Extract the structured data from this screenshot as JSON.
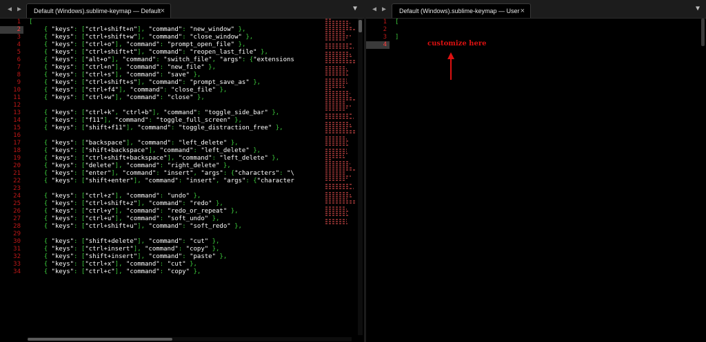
{
  "left_pane": {
    "tab_title": "Default (Windows).sublime-keymap — Default",
    "close_glyph": "×",
    "nav_back": "◀",
    "nav_forward": "▶",
    "dropdown_glyph": "▼",
    "lines": [
      "[",
      "    { \"keys\": [\"ctrl+shift+n\"], \"command\": \"new_window\" },",
      "    { \"keys\": [\"ctrl+shift+w\"], \"command\": \"close_window\" },",
      "    { \"keys\": [\"ctrl+o\"], \"command\": \"prompt_open_file\" },",
      "    { \"keys\": [\"ctrl+shift+t\"], \"command\": \"reopen_last_file\" },",
      "    { \"keys\": [\"alt+o\"], \"command\": \"switch_file\", \"args\": {\"extensions",
      "    { \"keys\": [\"ctrl+n\"], \"command\": \"new_file\" },",
      "    { \"keys\": [\"ctrl+s\"], \"command\": \"save\" },",
      "    { \"keys\": [\"ctrl+shift+s\"], \"command\": \"prompt_save_as\" },",
      "    { \"keys\": [\"ctrl+f4\"], \"command\": \"close_file\" },",
      "    { \"keys\": [\"ctrl+w\"], \"command\": \"close\" },",
      "",
      "    { \"keys\": [\"ctrl+k\", \"ctrl+b\"], \"command\": \"toggle_side_bar\" },",
      "    { \"keys\": [\"f11\"], \"command\": \"toggle_full_screen\" },",
      "    { \"keys\": [\"shift+f11\"], \"command\": \"toggle_distraction_free\" },",
      "",
      "    { \"keys\": [\"backspace\"], \"command\": \"left_delete\" },",
      "    { \"keys\": [\"shift+backspace\"], \"command\": \"left_delete\" },",
      "    { \"keys\": [\"ctrl+shift+backspace\"], \"command\": \"left_delete\" },",
      "    { \"keys\": [\"delete\"], \"command\": \"right_delete\" },",
      "    { \"keys\": [\"enter\"], \"command\": \"insert\", \"args\": {\"characters\": \"\\",
      "    { \"keys\": [\"shift+enter\"], \"command\": \"insert\", \"args\": {\"character",
      "",
      "    { \"keys\": [\"ctrl+z\"], \"command\": \"undo\" },",
      "    { \"keys\": [\"ctrl+shift+z\"], \"command\": \"redo\" },",
      "    { \"keys\": [\"ctrl+y\"], \"command\": \"redo_or_repeat\" },",
      "    { \"keys\": [\"ctrl+u\"], \"command\": \"soft_undo\" },",
      "    { \"keys\": [\"ctrl+shift+u\"], \"command\": \"soft_redo\" },",
      "",
      "    { \"keys\": [\"shift+delete\"], \"command\": \"cut\" },",
      "    { \"keys\": [\"ctrl+insert\"], \"command\": \"copy\" },",
      "    { \"keys\": [\"shift+insert\"], \"command\": \"paste\" },",
      "    { \"keys\": [\"ctrl+x\"], \"command\": \"cut\" },",
      "    { \"keys\": [\"ctrl+c\"], \"command\": \"copy\" },"
    ],
    "active_line": 2
  },
  "right_pane": {
    "tab_title": "Default (Windows).sublime-keymap — User",
    "close_glyph": "×",
    "nav_back": "◀",
    "nav_forward": "▶",
    "dropdown_glyph": "▼",
    "lines": [
      "[",
      "",
      "]",
      ""
    ],
    "active_line": 4,
    "annotation": "customize here"
  },
  "colors": {
    "line_numbers": "#c01818",
    "punctuation": "#3cc93c",
    "strings": "#ffffff",
    "annotation": "#dd1111"
  }
}
